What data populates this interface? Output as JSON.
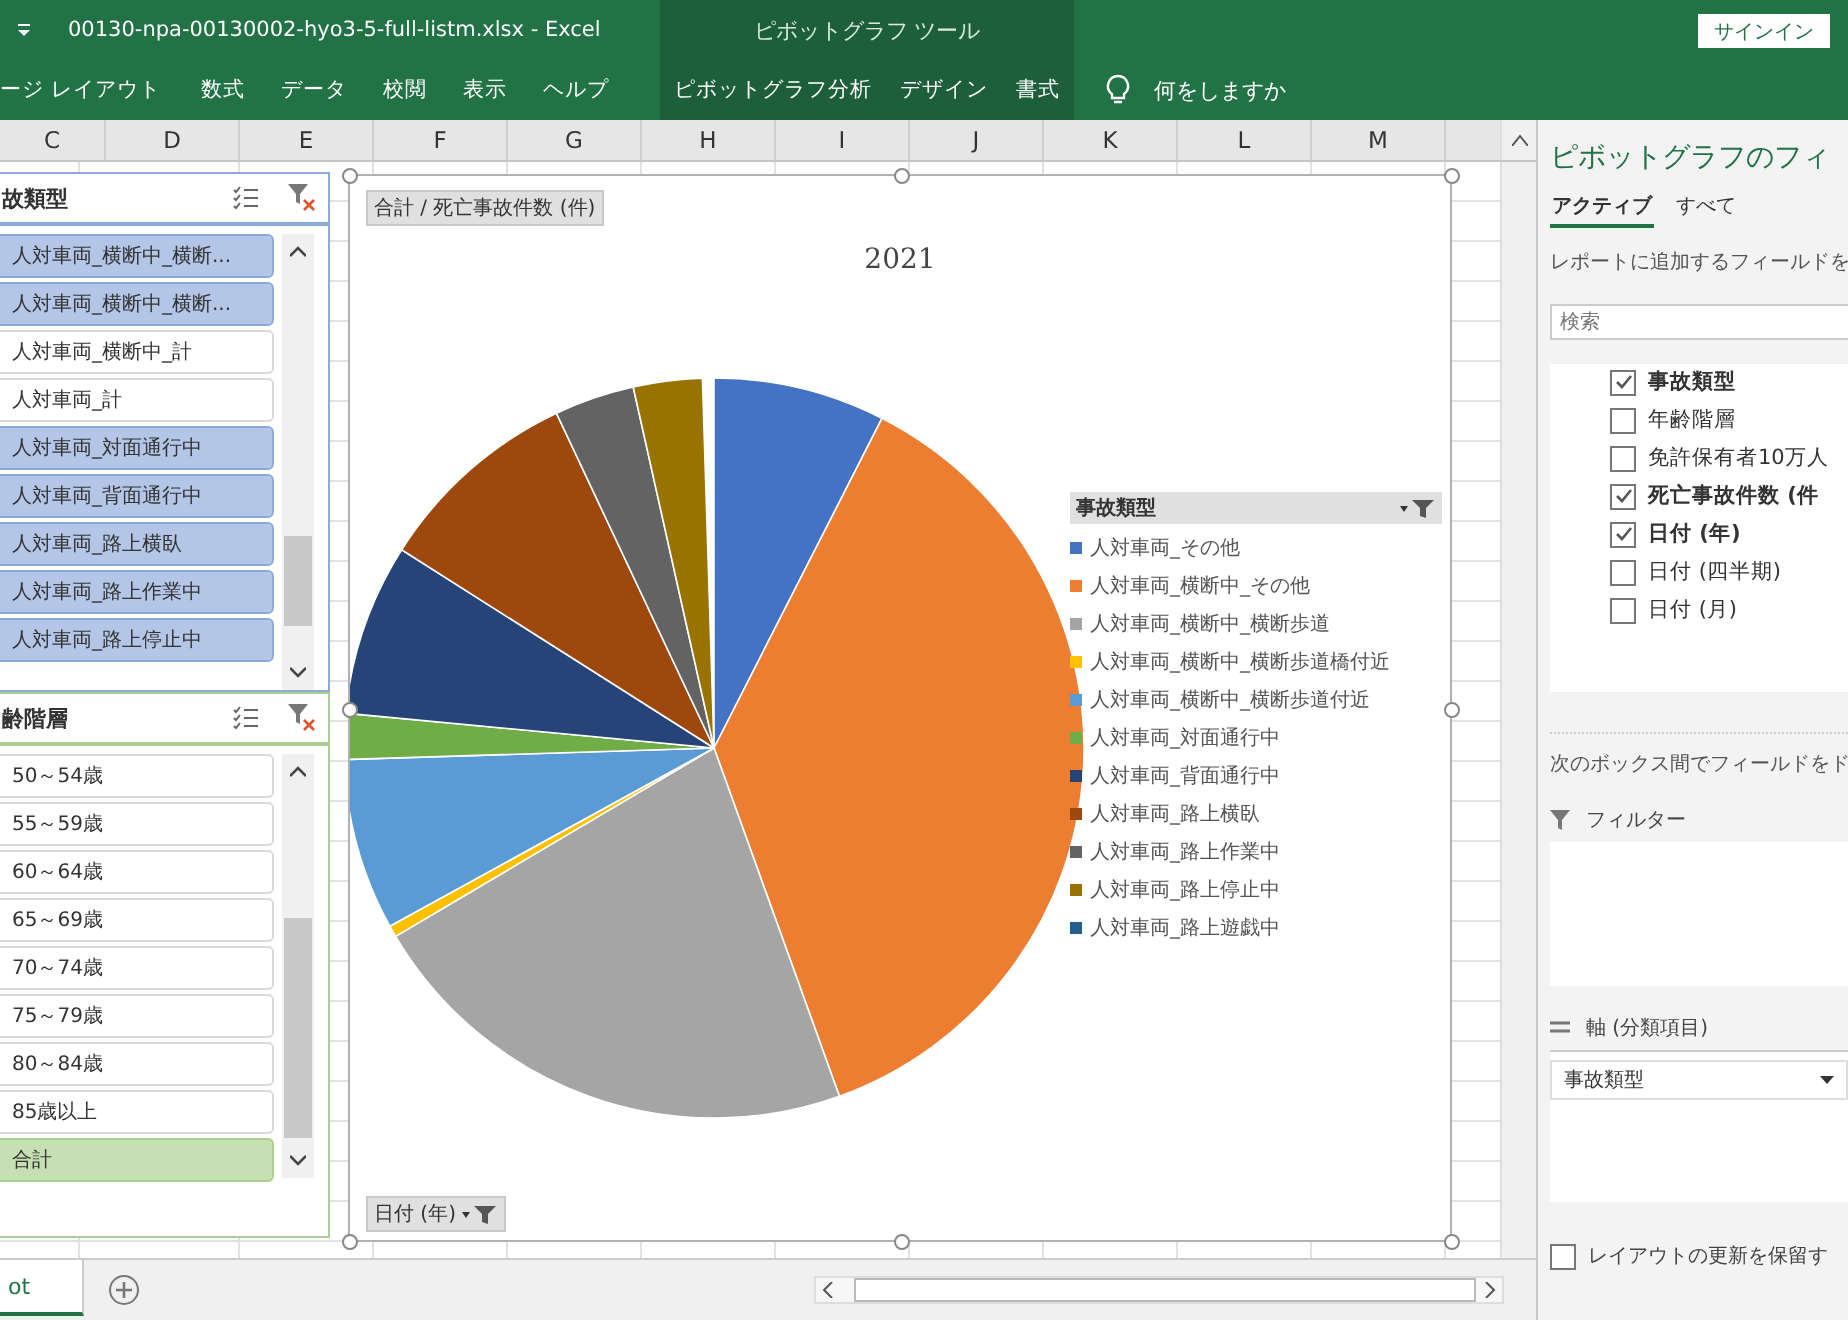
{
  "title_bar": {
    "file_title": "00130-npa-00130002-hyo3-5-full-listm.xlsx  -  Excel",
    "context_title": "ピボットグラフ ツール",
    "sign_in": "サインイン"
  },
  "ribbon_tabs": [
    {
      "label": "ージ レイアウト",
      "kind": "standard"
    },
    {
      "label": "数式",
      "kind": "standard"
    },
    {
      "label": "データ",
      "kind": "standard"
    },
    {
      "label": "校閲",
      "kind": "standard"
    },
    {
      "label": "表示",
      "kind": "standard"
    },
    {
      "label": "ヘルプ",
      "kind": "standard"
    },
    {
      "label": "ピボットグラフ分析",
      "kind": "contextual"
    },
    {
      "label": "デザイン",
      "kind": "contextual"
    },
    {
      "label": "書式",
      "kind": "contextual"
    }
  ],
  "tell_me": "何をしますか",
  "columns": [
    "C",
    "D",
    "E",
    "F",
    "G",
    "H",
    "I",
    "J",
    "K",
    "L",
    "M"
  ],
  "slicers": [
    {
      "title": "故類型",
      "kind": "blue",
      "items": [
        {
          "label": "人対車両_横断中_横断...",
          "selected": true
        },
        {
          "label": "人対車両_横断中_横断...",
          "selected": true
        },
        {
          "label": "人対車両_横断中_計",
          "selected": false
        },
        {
          "label": "人対車両_計",
          "selected": false
        },
        {
          "label": "人対車両_対面通行中",
          "selected": true
        },
        {
          "label": "人対車両_背面通行中",
          "selected": true
        },
        {
          "label": "人対車両_路上横臥",
          "selected": true
        },
        {
          "label": "人対車両_路上作業中",
          "selected": true
        },
        {
          "label": "人対車両_路上停止中",
          "selected": true
        }
      ]
    },
    {
      "title": "齢階層",
      "kind": "green",
      "items": [
        {
          "label": "50～54歳",
          "selected": false
        },
        {
          "label": "55～59歳",
          "selected": false
        },
        {
          "label": "60～64歳",
          "selected": false
        },
        {
          "label": "65～69歳",
          "selected": false
        },
        {
          "label": "70～74歳",
          "selected": false
        },
        {
          "label": "75～79歳",
          "selected": false
        },
        {
          "label": "80～84歳",
          "selected": false
        },
        {
          "label": "85歳以上",
          "selected": false
        },
        {
          "label": "合計",
          "selected": true
        }
      ]
    }
  ],
  "chart": {
    "value_button": "合計 / 死亡事故件数 (件)",
    "title": "2021",
    "legend_title": "事故類型",
    "axis_button": "日付 (年)",
    "legend": [
      {
        "label": "人対車両_その他",
        "color": "#4472c4"
      },
      {
        "label": "人対車両_横断中_その他",
        "color": "#ed7d31"
      },
      {
        "label": "人対車両_横断中_横断歩道",
        "color": "#a5a5a5"
      },
      {
        "label": "人対車両_横断中_横断歩道橋付近",
        "color": "#ffc000"
      },
      {
        "label": "人対車両_横断中_横断歩道付近",
        "color": "#5b9bd5"
      },
      {
        "label": "人対車両_対面通行中",
        "color": "#70ad47"
      },
      {
        "label": "人対車両_背面通行中",
        "color": "#264478"
      },
      {
        "label": "人対車両_路上横臥",
        "color": "#9e480e"
      },
      {
        "label": "人対車両_路上作業中",
        "color": "#636363"
      },
      {
        "label": "人対車両_路上停止中",
        "color": "#997300"
      },
      {
        "label": "人対車両_路上遊戯中",
        "color": "#255e91"
      }
    ]
  },
  "field_panel": {
    "title": "ピボットグラフのフィ",
    "tabs": [
      {
        "label": "アクティブ",
        "selected": true
      },
      {
        "label": "すべて",
        "selected": false
      }
    ],
    "hint": "レポートに追加するフィールドを",
    "search_placeholder": "検索",
    "fields": [
      {
        "label": "事故類型",
        "checked": true
      },
      {
        "label": "年齢階層",
        "checked": false
      },
      {
        "label": "免許保有者10万人",
        "checked": false
      },
      {
        "label": "死亡事故件数 (件",
        "checked": true
      },
      {
        "label": "日付 (年)",
        "checked": true
      },
      {
        "label": "日付 (四半期)",
        "checked": false
      },
      {
        "label": "日付 (月)",
        "checked": false
      }
    ],
    "drag_hint": "次のボックス間でフィールドをド",
    "filter_label": "フィルター",
    "axis_label": "軸 (分類項目)",
    "axis_field": "事故類型",
    "defer_label": "レイアウトの更新を保留す",
    "defer_checked": false
  },
  "sheet_tabs": [
    {
      "label": "ot",
      "selected": true
    }
  ]
}
